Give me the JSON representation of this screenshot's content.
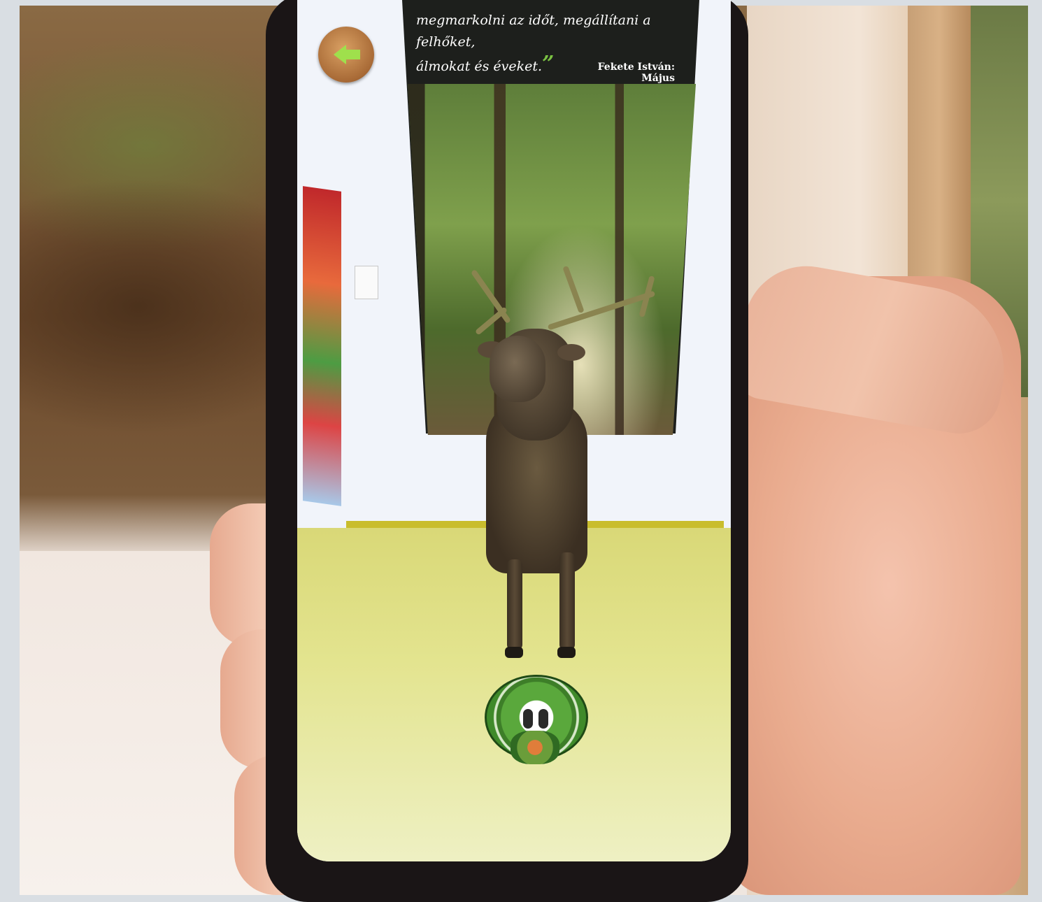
{
  "scene": {
    "description_bg_colors": {
      "wall": "#f1f4fa",
      "floor": "#e3e48f",
      "accent_green": "#7ac142",
      "back_button": "#a86a36"
    }
  },
  "app": {
    "quote": {
      "line1": "megmarkolni az időt, megállítani a felhőket,",
      "line2": "álmokat és éveket.",
      "close_mark": "”",
      "author": "Fekete István: Május"
    },
    "back_button": {
      "icon": "arrow-left-icon"
    },
    "ar_marker": {
      "icon": "ar-marker-icon"
    }
  }
}
